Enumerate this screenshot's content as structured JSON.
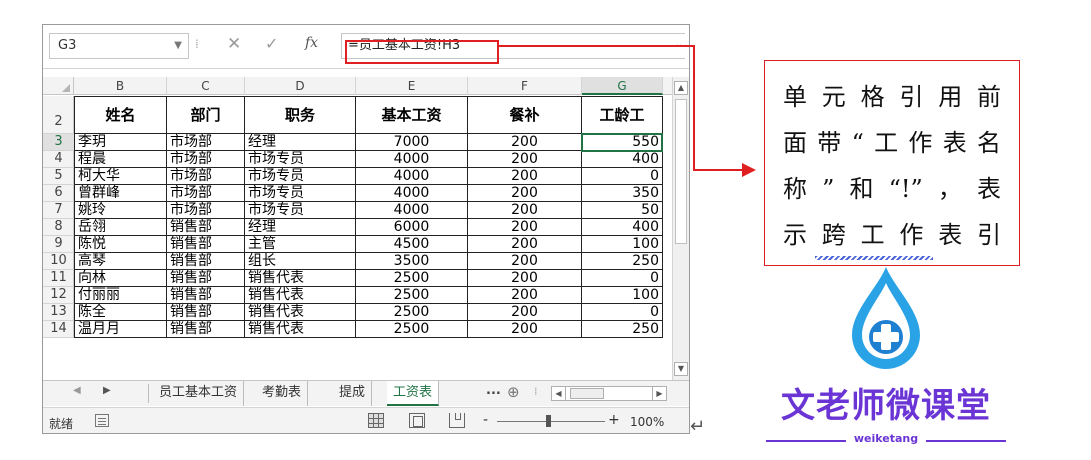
{
  "namebox": {
    "value": "G3"
  },
  "formula_bar": {
    "fx": "fx",
    "formula": "=员工基本工资!H3"
  },
  "columns": [
    "B",
    "C",
    "D",
    "E",
    "F",
    "G"
  ],
  "rows": [
    "2",
    "3",
    "4",
    "5",
    "6",
    "7",
    "8",
    "9",
    "10",
    "11",
    "12",
    "13",
    "14"
  ],
  "headers": [
    "姓名",
    "部门",
    "职务",
    "基本工资",
    "餐补",
    "工龄工"
  ],
  "data": [
    [
      "李玥",
      "市场部",
      "经理",
      "7000",
      "200",
      "550"
    ],
    [
      "程晨",
      "市场部",
      "市场专员",
      "4000",
      "200",
      "400"
    ],
    [
      "柯大华",
      "市场部",
      "市场专员",
      "4000",
      "200",
      "0"
    ],
    [
      "曾群峰",
      "市场部",
      "市场专员",
      "4000",
      "200",
      "350"
    ],
    [
      "姚玲",
      "市场部",
      "市场专员",
      "4000",
      "200",
      "50"
    ],
    [
      "岳翎",
      "销售部",
      "经理",
      "6000",
      "200",
      "400"
    ],
    [
      "陈悦",
      "销售部",
      "主管",
      "4500",
      "200",
      "100"
    ],
    [
      "高琴",
      "销售部",
      "组长",
      "3500",
      "200",
      "250"
    ],
    [
      "向林",
      "销售部",
      "销售代表",
      "2500",
      "200",
      "0"
    ],
    [
      "付丽丽",
      "销售部",
      "销售代表",
      "2500",
      "200",
      "100"
    ],
    [
      "陈全",
      "销售部",
      "销售代表",
      "2500",
      "200",
      "0"
    ],
    [
      "温月月",
      "销售部",
      "销售代表",
      "2500",
      "200",
      "250"
    ]
  ],
  "sheet_tabs": [
    {
      "label": "员工基本工资",
      "active": false
    },
    {
      "label": "考勤表",
      "active": false
    },
    {
      "label": "提成",
      "active": false
    },
    {
      "label": "工资表",
      "active": true
    }
  ],
  "tab_more": "...",
  "status": {
    "ready": "就绪",
    "zoom_minus": "-",
    "zoom_plus": "+",
    "zoom": "100%"
  },
  "note": {
    "lines": [
      "单元格引用前",
      "面带“工作表名",
      "称”和“!”，表",
      "示跨工作表引"
    ]
  },
  "logo": {
    "name": "文老师微课堂",
    "sub": "weiketang"
  },
  "colors": {
    "accent": "#217346",
    "highlight": "#e02020",
    "logo": "#6b35d6",
    "drop": "#29a3e6"
  }
}
